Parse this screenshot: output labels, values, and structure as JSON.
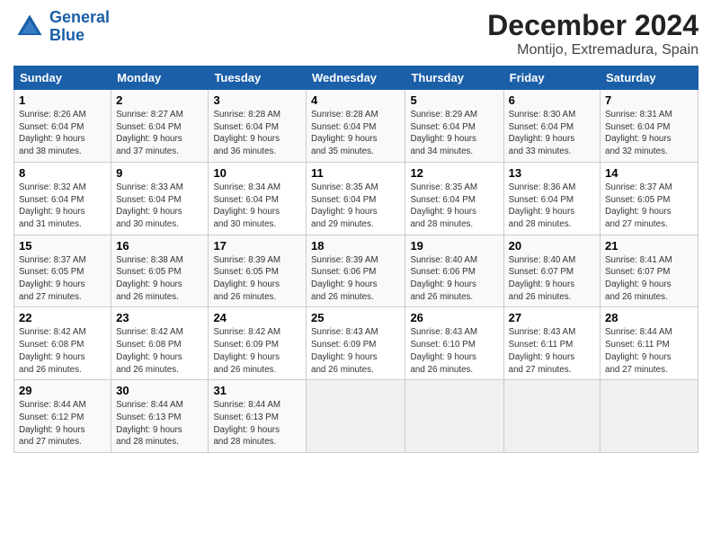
{
  "logo": {
    "line1": "General",
    "line2": "Blue"
  },
  "title": "December 2024",
  "location": "Montijo, Extremadura, Spain",
  "weekdays": [
    "Sunday",
    "Monday",
    "Tuesday",
    "Wednesday",
    "Thursday",
    "Friday",
    "Saturday"
  ],
  "weeks": [
    [
      {
        "day": "1",
        "info": "Sunrise: 8:26 AM\nSunset: 6:04 PM\nDaylight: 9 hours\nand 38 minutes."
      },
      {
        "day": "2",
        "info": "Sunrise: 8:27 AM\nSunset: 6:04 PM\nDaylight: 9 hours\nand 37 minutes."
      },
      {
        "day": "3",
        "info": "Sunrise: 8:28 AM\nSunset: 6:04 PM\nDaylight: 9 hours\nand 36 minutes."
      },
      {
        "day": "4",
        "info": "Sunrise: 8:28 AM\nSunset: 6:04 PM\nDaylight: 9 hours\nand 35 minutes."
      },
      {
        "day": "5",
        "info": "Sunrise: 8:29 AM\nSunset: 6:04 PM\nDaylight: 9 hours\nand 34 minutes."
      },
      {
        "day": "6",
        "info": "Sunrise: 8:30 AM\nSunset: 6:04 PM\nDaylight: 9 hours\nand 33 minutes."
      },
      {
        "day": "7",
        "info": "Sunrise: 8:31 AM\nSunset: 6:04 PM\nDaylight: 9 hours\nand 32 minutes."
      }
    ],
    [
      {
        "day": "8",
        "info": "Sunrise: 8:32 AM\nSunset: 6:04 PM\nDaylight: 9 hours\nand 31 minutes."
      },
      {
        "day": "9",
        "info": "Sunrise: 8:33 AM\nSunset: 6:04 PM\nDaylight: 9 hours\nand 30 minutes."
      },
      {
        "day": "10",
        "info": "Sunrise: 8:34 AM\nSunset: 6:04 PM\nDaylight: 9 hours\nand 30 minutes."
      },
      {
        "day": "11",
        "info": "Sunrise: 8:35 AM\nSunset: 6:04 PM\nDaylight: 9 hours\nand 29 minutes."
      },
      {
        "day": "12",
        "info": "Sunrise: 8:35 AM\nSunset: 6:04 PM\nDaylight: 9 hours\nand 28 minutes."
      },
      {
        "day": "13",
        "info": "Sunrise: 8:36 AM\nSunset: 6:04 PM\nDaylight: 9 hours\nand 28 minutes."
      },
      {
        "day": "14",
        "info": "Sunrise: 8:37 AM\nSunset: 6:05 PM\nDaylight: 9 hours\nand 27 minutes."
      }
    ],
    [
      {
        "day": "15",
        "info": "Sunrise: 8:37 AM\nSunset: 6:05 PM\nDaylight: 9 hours\nand 27 minutes."
      },
      {
        "day": "16",
        "info": "Sunrise: 8:38 AM\nSunset: 6:05 PM\nDaylight: 9 hours\nand 26 minutes."
      },
      {
        "day": "17",
        "info": "Sunrise: 8:39 AM\nSunset: 6:05 PM\nDaylight: 9 hours\nand 26 minutes."
      },
      {
        "day": "18",
        "info": "Sunrise: 8:39 AM\nSunset: 6:06 PM\nDaylight: 9 hours\nand 26 minutes."
      },
      {
        "day": "19",
        "info": "Sunrise: 8:40 AM\nSunset: 6:06 PM\nDaylight: 9 hours\nand 26 minutes."
      },
      {
        "day": "20",
        "info": "Sunrise: 8:40 AM\nSunset: 6:07 PM\nDaylight: 9 hours\nand 26 minutes."
      },
      {
        "day": "21",
        "info": "Sunrise: 8:41 AM\nSunset: 6:07 PM\nDaylight: 9 hours\nand 26 minutes."
      }
    ],
    [
      {
        "day": "22",
        "info": "Sunrise: 8:42 AM\nSunset: 6:08 PM\nDaylight: 9 hours\nand 26 minutes."
      },
      {
        "day": "23",
        "info": "Sunrise: 8:42 AM\nSunset: 6:08 PM\nDaylight: 9 hours\nand 26 minutes."
      },
      {
        "day": "24",
        "info": "Sunrise: 8:42 AM\nSunset: 6:09 PM\nDaylight: 9 hours\nand 26 minutes."
      },
      {
        "day": "25",
        "info": "Sunrise: 8:43 AM\nSunset: 6:09 PM\nDaylight: 9 hours\nand 26 minutes."
      },
      {
        "day": "26",
        "info": "Sunrise: 8:43 AM\nSunset: 6:10 PM\nDaylight: 9 hours\nand 26 minutes."
      },
      {
        "day": "27",
        "info": "Sunrise: 8:43 AM\nSunset: 6:11 PM\nDaylight: 9 hours\nand 27 minutes."
      },
      {
        "day": "28",
        "info": "Sunrise: 8:44 AM\nSunset: 6:11 PM\nDaylight: 9 hours\nand 27 minutes."
      }
    ],
    [
      {
        "day": "29",
        "info": "Sunrise: 8:44 AM\nSunset: 6:12 PM\nDaylight: 9 hours\nand 27 minutes."
      },
      {
        "day": "30",
        "info": "Sunrise: 8:44 AM\nSunset: 6:13 PM\nDaylight: 9 hours\nand 28 minutes."
      },
      {
        "day": "31",
        "info": "Sunrise: 8:44 AM\nSunset: 6:13 PM\nDaylight: 9 hours\nand 28 minutes."
      },
      null,
      null,
      null,
      null
    ]
  ]
}
